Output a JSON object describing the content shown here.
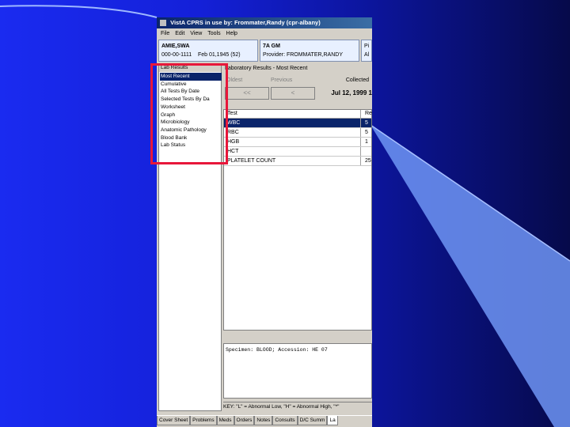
{
  "window": {
    "title": "VistA CPRS in use by: Frommater,Randy  (cpr-albany)"
  },
  "menu": [
    "File",
    "Edit",
    "View",
    "Tools",
    "Help"
  ],
  "patient": {
    "name": "AMIE,SWA",
    "ssn": "000-00-1111",
    "dob": "Feb 01,1945 (52)",
    "location": "7A GM",
    "provider": "Provider: FROMMATER,RANDY",
    "extra1": "Pi",
    "extra2": "Al"
  },
  "lab_results": {
    "header": "Lab Results",
    "items": [
      "Most Recent",
      "Cumulative",
      "All Tests By Date",
      "Selected Tests By Da",
      "Worksheet",
      "Graph",
      "Microbiology",
      "Anatomic Pathology",
      "Blood Bank",
      "Lab Status"
    ],
    "selected_index": 0
  },
  "main": {
    "header": "Laboratory Results - Most Recent",
    "oldest_label": "Oldest",
    "previous_label": "Previous",
    "oldest_btn": "<<",
    "previous_btn": "<",
    "collected_label": "Collected",
    "collected_date": "Jul 12, 1999 1",
    "table": {
      "col_test": "Test",
      "col_result": "Resu",
      "rows": [
        {
          "test": "WBC",
          "result": "5",
          "selected": true
        },
        {
          "test": "RBC",
          "result": "5",
          "selected": false
        },
        {
          "test": "HGB",
          "result": "1",
          "selected": false
        },
        {
          "test": "HCT",
          "result": "",
          "selected": false
        },
        {
          "test": "PLATELET COUNT",
          "result": "25",
          "selected": false
        }
      ]
    },
    "specimen_text": "Specimen: BLOOD;     Accession: HE 07",
    "key_text": "KEY: \"L\" = Abnormal Low, \"H\" = Abnormal High, \"*\""
  },
  "tabs": [
    "Cover Sheet",
    "Problems",
    "Meds",
    "Orders",
    "Notes",
    "Consults",
    "D/C Summ",
    "La"
  ],
  "colors": {
    "highlight": "#e8173a",
    "selection": "#0a246a"
  }
}
